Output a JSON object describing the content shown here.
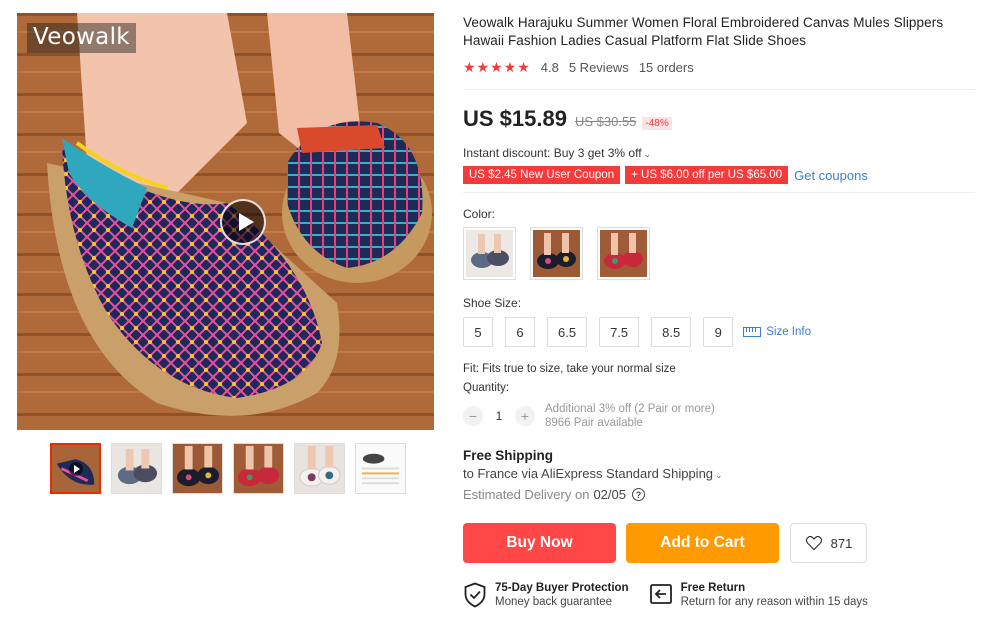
{
  "gallery": {
    "watermark": "Veowalk",
    "thumbnails": [
      "video-thumb",
      "blue-grey-pair",
      "black-floral-pair",
      "red-floral-pair",
      "white-floral-pair",
      "size-chart"
    ]
  },
  "product": {
    "title": "Veowalk Harajuku Summer Women Floral Embroidered Canvas Mules Slippers Hawaii Fashion Ladies Casual Platform Flat Slide Shoes",
    "stars": "★★★★★",
    "rating": "4.8",
    "reviews": "5 Reviews",
    "orders": "15 orders"
  },
  "price": {
    "current": "US $15.89",
    "original": "US $30.55",
    "discount": "-48%"
  },
  "promo": {
    "instant_discount": "Instant discount: Buy 3 get 3% off",
    "coupon1": "US $2.45 New User Coupon",
    "coupon2": "+ US $6.00 off per US $65.00",
    "get_coupons": "Get coupons"
  },
  "options": {
    "color_label": "Color:",
    "size_label": "Shoe Size:",
    "sizes": [
      "5",
      "6",
      "6.5",
      "7.5",
      "8.5",
      "9"
    ],
    "size_info": "Size Info",
    "fit": "Fit: Fits true to size, take your normal size"
  },
  "quantity": {
    "label": "Quantity:",
    "minus": "−",
    "value": "1",
    "plus": "+",
    "note1": "Additional 3% off (2 Pair or more)",
    "note2": "8966 Pair available"
  },
  "shipping": {
    "title": "Free Shipping",
    "to": "to France via AliExpress Standard Shipping",
    "delivery_label": "Estimated Delivery on",
    "delivery_date": "02/05"
  },
  "actions": {
    "buy_now": "Buy Now",
    "add_to_cart": "Add to Cart",
    "wishlist_count": "871"
  },
  "guarantees": {
    "protection_title": "75-Day Buyer Protection",
    "protection_sub": "Money back guarantee",
    "return_title": "Free Return",
    "return_sub": "Return for any reason within 15 days"
  },
  "colors": {
    "accent_red": "#ff4747",
    "accent_orange": "#ff9a00",
    "link_blue": "#3a7ecf"
  }
}
